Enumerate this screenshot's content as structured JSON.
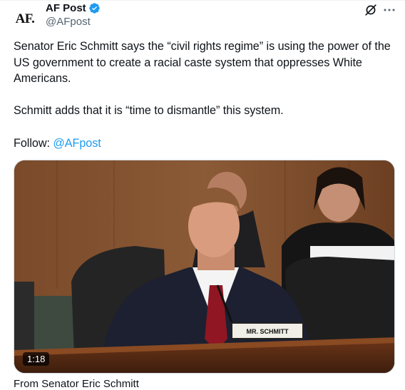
{
  "author": {
    "avatar_text": "AF.",
    "name": "AF Post",
    "handle": "@AFpost",
    "verified": true
  },
  "header_icons": [
    "grok-icon",
    "more-icon"
  ],
  "tweet": {
    "line1": "Senator Eric Schmitt says the “civil rights regime” is using the power of the US government to create a racial caste system that oppresses White Americans.",
    "line2": "Schmitt adds that it is “time to dismantle” this system.",
    "follow_label": "Follow: ",
    "follow_mention": "@AFpost"
  },
  "media": {
    "nameplate": "MR. SCHMITT",
    "duration": "1:18"
  },
  "below": {
    "partial_text": "From Senator Eric Schmitt"
  },
  "colors": {
    "accent": "#1d9bf0",
    "text": "#0f1419",
    "secondary": "#536471"
  }
}
